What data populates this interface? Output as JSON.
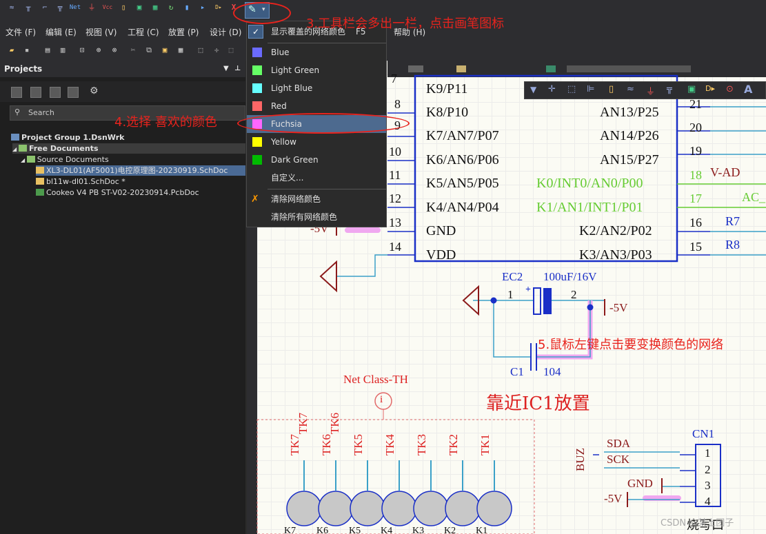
{
  "toolbar_top": {
    "active_tool": "pen-icon"
  },
  "menu": [
    "文件 (F)",
    "编辑 (E)",
    "视图 (V)",
    "工程 (C)",
    "放置 (P)",
    "设计 (D)",
    "帮助 (H)"
  ],
  "projects": {
    "title": "Projects",
    "search_placeholder": "Search",
    "tree": [
      "Project Group 1.DsnWrk",
      "Free Documents",
      "Source Documents",
      "XL3-DL01(AF5001)电控原理图-20230919.SchDoc",
      "bl11w-dl01.SchDoc *",
      "Cookeo V4 PB ST-V02-20230914.PcbDoc"
    ]
  },
  "dropdown": {
    "header": "显示覆盖的网络颜色",
    "shortcut": "F5",
    "colors": [
      {
        "label": "Blue",
        "color": "#6b6bff"
      },
      {
        "label": "Light Green",
        "color": "#66ff66"
      },
      {
        "label": "Light Blue",
        "color": "#66ffff"
      },
      {
        "label": "Red",
        "color": "#ff6666"
      },
      {
        "label": "Fuchsia",
        "color": "#ff66ff"
      },
      {
        "label": "Yellow",
        "color": "#ffff00"
      },
      {
        "label": "Dark Green",
        "color": "#00bb00"
      }
    ],
    "custom": "自定义...",
    "clear": "清除网络颜色",
    "clear_all": "清除所有网络颜色"
  },
  "annotations": {
    "a3": "3.工具栏会多出一栏，点击画笔图标",
    "a4": "4.选择 喜欢的颜色",
    "a5": "5.鼠标左键点击要变换颜色的网络"
  },
  "schematic": {
    "pins_left": [
      {
        "num": "7",
        "name": "K9/P11"
      },
      {
        "num": "8",
        "name": "K8/P10"
      },
      {
        "num": "9",
        "name": "K7/AN7/P07"
      },
      {
        "num": "10",
        "name": "K6/AN6/P06"
      },
      {
        "num": "11",
        "name": "K5/AN5/P05"
      },
      {
        "num": "12",
        "name": "K4/AN4/P04"
      },
      {
        "num": "13",
        "name": "GND"
      },
      {
        "num": "14",
        "name": "VDD"
      }
    ],
    "pins_right": [
      {
        "num": "",
        "name": ""
      },
      {
        "num": "21",
        "name": "AN13/P25"
      },
      {
        "num": "20",
        "name": "AN14/P26"
      },
      {
        "num": "19",
        "name": "AN15/P27"
      },
      {
        "num": "18",
        "name": "K0/INT0/AN0/P00"
      },
      {
        "num": "17",
        "name": "K1/AN1/INT1/P01"
      },
      {
        "num": "16",
        "name": "K2/AN2/P02"
      },
      {
        "num": "15",
        "name": "K3/AN3/P03"
      }
    ],
    "net_labels": {
      "vad": "V-AD",
      "ac": "AC_",
      "r7": "R7",
      "r8": "R8",
      "neg5": "-5V",
      "neg5b": "-5V",
      "neg5c": "-5V"
    },
    "ec2": {
      "ref": "EC2",
      "value": "100uF/16V",
      "p1": "1",
      "p2": "2"
    },
    "c1": {
      "ref": "C1",
      "value": "104"
    },
    "netclass": "Net Class-TH",
    "note": "靠近IC1放置",
    "tk": [
      "TK7",
      "TK6",
      "TK5",
      "TK4",
      "TK3",
      "TK2",
      "TK1"
    ],
    "k": [
      "K7",
      "K6",
      "K5",
      "K4",
      "K3",
      "K2",
      "K1"
    ],
    "buz": "BUZ",
    "cn1": {
      "ref": "CN1",
      "pins": [
        "1",
        "2",
        "3",
        "4"
      ],
      "nets": [
        "SDA",
        "SCK",
        "GND",
        "-5V"
      ],
      "title": "烧写口"
    }
  },
  "watermark": "CSDN @某上团子"
}
